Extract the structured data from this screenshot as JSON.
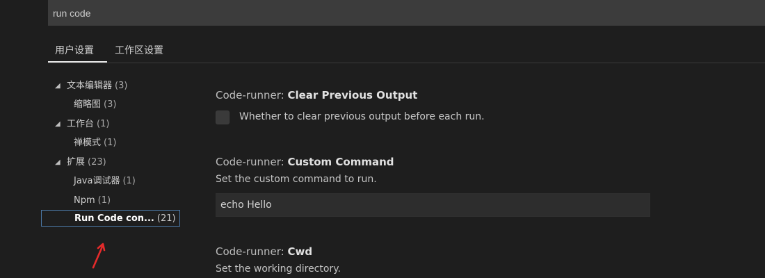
{
  "search": {
    "value": "run code"
  },
  "tabs": [
    {
      "label": "用户设置",
      "active": true
    },
    {
      "label": "工作区设置",
      "active": false
    }
  ],
  "sidebar": {
    "items": [
      {
        "label": "文本编辑器",
        "count": "(3)",
        "expanded": true,
        "level": 0
      },
      {
        "label": "缩略图",
        "count": "(3)",
        "level": 1
      },
      {
        "label": "工作台",
        "count": "(1)",
        "expanded": true,
        "level": 0
      },
      {
        "label": "禅模式",
        "count": "(1)",
        "level": 1
      },
      {
        "label": "扩展",
        "count": "(23)",
        "expanded": true,
        "level": 0
      },
      {
        "label": "Java调试器",
        "count": "(1)",
        "level": 1
      },
      {
        "label": "Npm",
        "count": "(1)",
        "level": 1
      },
      {
        "label": "Run Code con...",
        "count": "(21)",
        "level": 1,
        "active": true
      }
    ]
  },
  "settings": [
    {
      "prefix": "Code-runner: ",
      "name": "Clear Previous Output",
      "description": "Whether to clear previous output before each run.",
      "checked": false
    },
    {
      "prefix": "Code-runner: ",
      "name": "Custom Command",
      "description": "Set the custom command to run.",
      "value": "echo Hello"
    },
    {
      "prefix": "Code-runner: ",
      "name": "Cwd",
      "description": "Set the working directory."
    }
  ],
  "colors": {
    "background": "#1e1e1e",
    "search_background": "#3c3c3c",
    "input_background": "#2d2d2d",
    "active_border": "#4b78a5",
    "annotation_arrow": "#e62b2b"
  },
  "icons": {
    "expanded": "triangle-down-icon",
    "annotation": "red-arrow-icon"
  }
}
